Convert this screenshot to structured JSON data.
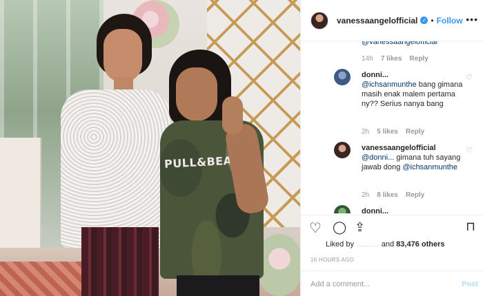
{
  "header": {
    "username": "vanessaangelofficial",
    "separator": "•",
    "follow_label": "Follow",
    "more_label": "•••",
    "verified_glyph": "✓"
  },
  "photo": {
    "shirt_print": "PULL&BEAR"
  },
  "comments": [
    {
      "text": "@vanessaangelofficial",
      "time": "14h",
      "likes": "7 likes",
      "reply": "Reply"
    },
    {
      "username": "donni...",
      "mention": "@ichsanmunthe",
      "text": " bang gimana masih enak malem pertama ny?? Serius nanya bang",
      "time": "2h",
      "likes": "5 likes",
      "reply": "Reply"
    },
    {
      "username": "vanessaangelofficial",
      "mention": "@donni...",
      "text": " gimana tuh sayang jawab dong ",
      "mention2": "@ichsanmunthe",
      "time": "2h",
      "likes": "8 likes",
      "reply": "Reply"
    },
    {
      "username": "donni..."
    }
  ],
  "likes": {
    "prefix": "Liked by",
    "blurred_name": "...........",
    "suffix": "and",
    "count_label": "83,476 others"
  },
  "timestamp": "16 HOURS AGO",
  "add_comment": {
    "placeholder": "Add a comment...",
    "post_label": "Post"
  },
  "icons": {
    "heart": "♡",
    "comment": "◯",
    "share": "⇪",
    "bookmark": "⊓"
  },
  "colors": {
    "link": "#3897f0",
    "mention": "#003569",
    "muted": "#999999"
  }
}
